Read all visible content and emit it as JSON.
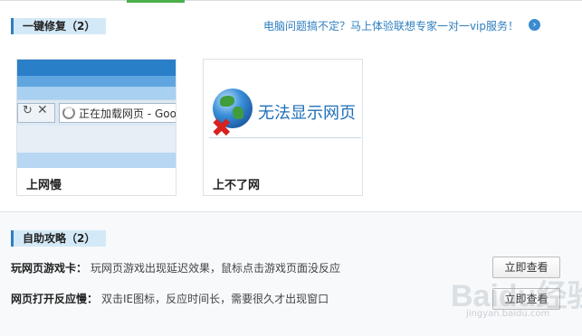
{
  "section1": {
    "title": "一键修复（2）",
    "vip_link": "电脑问题搞不定？马上体验联想专家一对一vip服务！",
    "vip_icon": "arrow-right-circle-icon",
    "cards": [
      {
        "label": "上网慢",
        "thumb": {
          "loading_text": "正在加载网页 - Goo"
        }
      },
      {
        "label": "上不了网",
        "thumb": {
          "message": "无法显示网页"
        }
      }
    ]
  },
  "section2": {
    "title": "自助攻略（2）",
    "items": [
      {
        "title": "玩网页游戏卡：",
        "desc": "玩网页游戏出现延迟效果，鼠标点击游戏页面没反应",
        "button": "立即查看"
      },
      {
        "title": "网页打开反应慢：",
        "desc": "双击IE图标，反应时间长，需要很久才出现窗口",
        "button": "立即查看"
      }
    ]
  },
  "watermark": {
    "main": "Baidu经验",
    "sub": "jingyan.baidu.com"
  },
  "colors": {
    "accent_blue": "#2f7fbf",
    "header_bg": "#d4e9f7",
    "tab_green": "#49b04a",
    "error_red": "#d72020"
  }
}
